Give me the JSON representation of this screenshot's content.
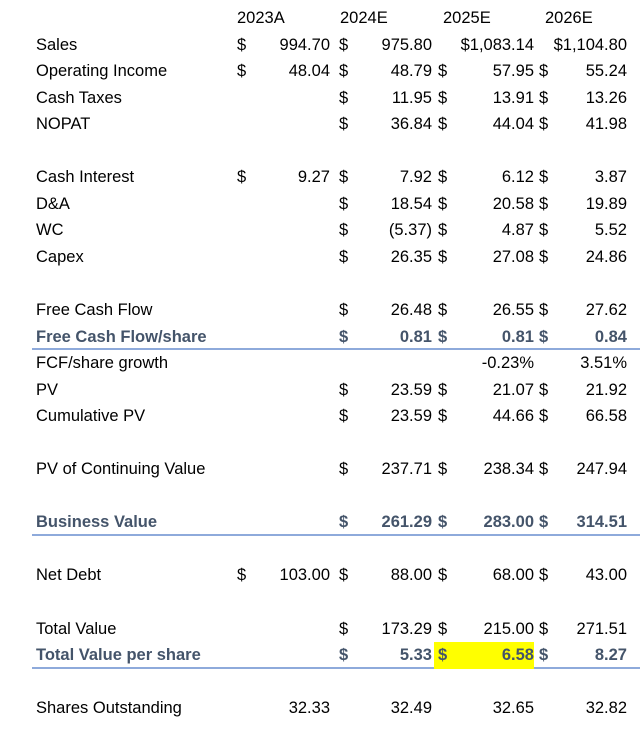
{
  "headers": [
    "2023A",
    "2024E",
    "2025E",
    "2026E"
  ],
  "highlight_color": "#ffff00",
  "accent_color": "#44546a",
  "rule_color": "#8eaadb",
  "rows": [
    {
      "label": "Sales",
      "cells": [
        {
          "cur": "$",
          "val": "994.70"
        },
        {
          "cur": "$",
          "val": "975.80"
        },
        {
          "cur": "",
          "val": "$1,083.14"
        },
        {
          "cur": "",
          "val": "$1,104.80"
        }
      ]
    },
    {
      "label": "Operating Income",
      "cells": [
        {
          "cur": "$",
          "val": "48.04"
        },
        {
          "cur": "$",
          "val": "48.79"
        },
        {
          "cur": "$",
          "val": "57.95"
        },
        {
          "cur": "$",
          "val": "55.24"
        }
      ]
    },
    {
      "label": "Cash Taxes",
      "cells": [
        null,
        {
          "cur": "$",
          "val": "11.95"
        },
        {
          "cur": "$",
          "val": "13.91"
        },
        {
          "cur": "$",
          "val": "13.26"
        }
      ]
    },
    {
      "label": "NOPAT",
      "cells": [
        null,
        {
          "cur": "$",
          "val": "36.84"
        },
        {
          "cur": "$",
          "val": "44.04"
        },
        {
          "cur": "$",
          "val": "41.98"
        }
      ]
    },
    {
      "blank": true
    },
    {
      "label": "Cash Interest",
      "cells": [
        {
          "cur": "$",
          "val": "9.27"
        },
        {
          "cur": "$",
          "val": "7.92"
        },
        {
          "cur": "$",
          "val": "6.12"
        },
        {
          "cur": "$",
          "val": "3.87"
        }
      ]
    },
    {
      "label": "D&A",
      "cells": [
        null,
        {
          "cur": "$",
          "val": "18.54"
        },
        {
          "cur": "$",
          "val": "20.58"
        },
        {
          "cur": "$",
          "val": "19.89"
        }
      ]
    },
    {
      "label": "WC",
      "cells": [
        null,
        {
          "cur": "$",
          "val": "(5.37)"
        },
        {
          "cur": "$",
          "val": "4.87"
        },
        {
          "cur": "$",
          "val": "5.52"
        }
      ]
    },
    {
      "label": "Capex",
      "cells": [
        null,
        {
          "cur": "$",
          "val": "26.35"
        },
        {
          "cur": "$",
          "val": "27.08"
        },
        {
          "cur": "$",
          "val": "24.86"
        }
      ]
    },
    {
      "blank": true
    },
    {
      "label": "Free Cash Flow",
      "cells": [
        null,
        {
          "cur": "$",
          "val": "26.48"
        },
        {
          "cur": "$",
          "val": "26.55"
        },
        {
          "cur": "$",
          "val": "27.62"
        }
      ]
    },
    {
      "label": "Free Cash Flow/share",
      "bold": true,
      "rule": true,
      "cells": [
        null,
        {
          "cur": "$",
          "val": "0.81"
        },
        {
          "cur": "$",
          "val": "0.81"
        },
        {
          "cur": "$",
          "val": "0.84"
        }
      ]
    },
    {
      "label": "FCF/share growth",
      "cells": [
        null,
        null,
        {
          "cur": "",
          "val": "-0.23%"
        },
        {
          "cur": "",
          "val": "3.51%"
        }
      ]
    },
    {
      "label": "PV",
      "cells": [
        null,
        {
          "cur": "$",
          "val": "23.59"
        },
        {
          "cur": "$",
          "val": "21.07"
        },
        {
          "cur": "$",
          "val": "21.92"
        }
      ]
    },
    {
      "label": "Cumulative PV",
      "cells": [
        null,
        {
          "cur": "$",
          "val": "23.59"
        },
        {
          "cur": "$",
          "val": "44.66"
        },
        {
          "cur": "$",
          "val": "66.58"
        }
      ]
    },
    {
      "blank": true
    },
    {
      "label": "PV of Continuing Value",
      "cells": [
        null,
        {
          "cur": "$",
          "val": "237.71"
        },
        {
          "cur": "$",
          "val": "238.34"
        },
        {
          "cur": "$",
          "val": "247.94"
        }
      ]
    },
    {
      "blank": true
    },
    {
      "label": "Business Value",
      "bold": true,
      "rule": true,
      "cells": [
        null,
        {
          "cur": "$",
          "val": "261.29"
        },
        {
          "cur": "$",
          "val": "283.00"
        },
        {
          "cur": "$",
          "val": "314.51"
        }
      ]
    },
    {
      "blank": true
    },
    {
      "label": "Net Debt",
      "cells": [
        {
          "cur": "$",
          "val": "103.00"
        },
        {
          "cur": "$",
          "val": "88.00"
        },
        {
          "cur": "$",
          "val": "68.00"
        },
        {
          "cur": "$",
          "val": "43.00"
        }
      ]
    },
    {
      "blank": true
    },
    {
      "label": "Total Value",
      "cells": [
        null,
        {
          "cur": "$",
          "val": "173.29"
        },
        {
          "cur": "$",
          "val": "215.00"
        },
        {
          "cur": "$",
          "val": "271.51"
        }
      ]
    },
    {
      "label": "Total Value per share",
      "bold": true,
      "rule": true,
      "cells": [
        null,
        {
          "cur": "$",
          "val": "5.33"
        },
        {
          "cur": "$",
          "val": "6.58",
          "highlight": true
        },
        {
          "cur": "$",
          "val": "8.27"
        }
      ]
    },
    {
      "blank": true
    },
    {
      "label": "Shares Outstanding",
      "cells": [
        {
          "cur": "",
          "val": "32.33"
        },
        {
          "cur": "",
          "val": "32.49"
        },
        {
          "cur": "",
          "val": "32.65"
        },
        {
          "cur": "",
          "val": "32.82"
        }
      ]
    }
  ]
}
